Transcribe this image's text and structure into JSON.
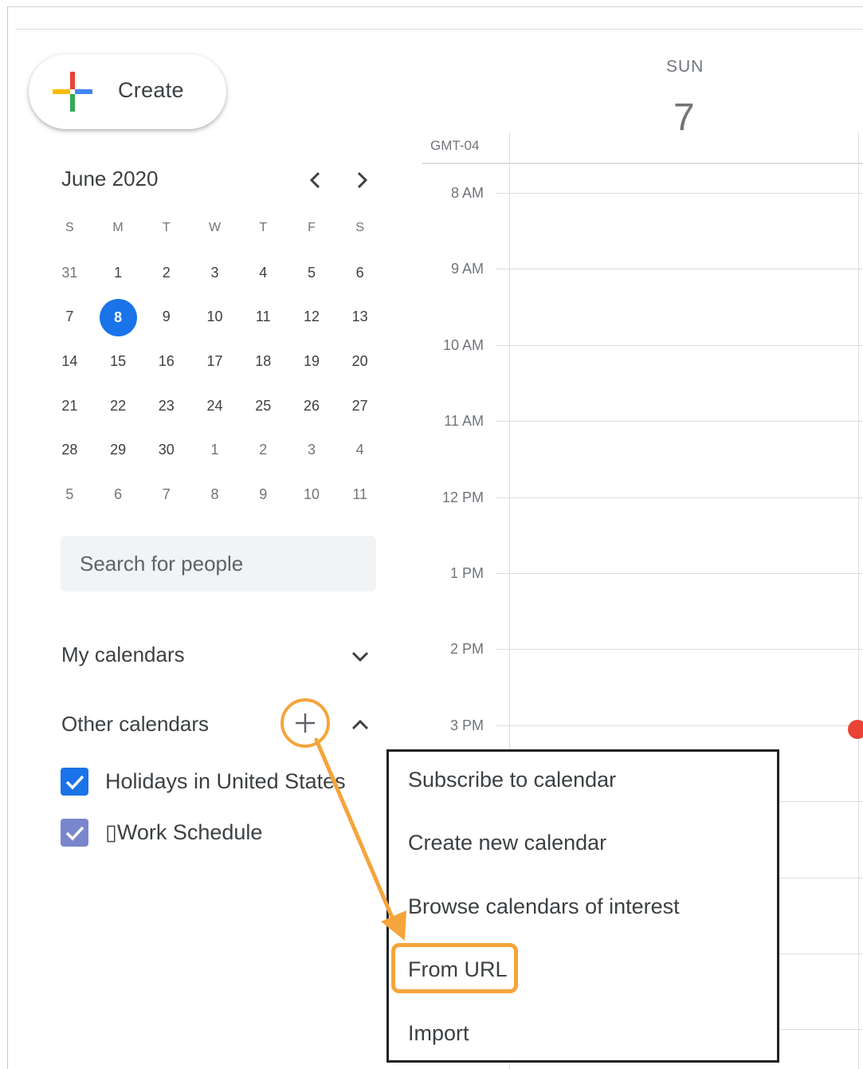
{
  "create_button": {
    "label": "Create"
  },
  "mini_calendar": {
    "month_title": "June 2020",
    "weekday_headers": [
      "S",
      "M",
      "T",
      "W",
      "T",
      "F",
      "S"
    ],
    "weeks": [
      [
        "31",
        "1",
        "2",
        "3",
        "4",
        "5",
        "6"
      ],
      [
        "7",
        "8",
        "9",
        "10",
        "11",
        "12",
        "13"
      ],
      [
        "14",
        "15",
        "16",
        "17",
        "18",
        "19",
        "20"
      ],
      [
        "21",
        "22",
        "23",
        "24",
        "25",
        "26",
        "27"
      ],
      [
        "28",
        "29",
        "30",
        "1",
        "2",
        "3",
        "4"
      ],
      [
        "5",
        "6",
        "7",
        "8",
        "9",
        "10",
        "11"
      ]
    ],
    "today": "8",
    "accent_color": "#1a73e8"
  },
  "search_people": {
    "placeholder": "Search for people"
  },
  "my_calendars": {
    "title": "My calendars"
  },
  "other_calendars": {
    "title": "Other calendars",
    "items": [
      {
        "label": "Holidays in United States",
        "color": "#1a73e8",
        "checked": true
      },
      {
        "label": "▯Work Schedule",
        "color": "#7986cb",
        "checked": true
      }
    ]
  },
  "day_view": {
    "day_name": "SUN",
    "day_number": "7",
    "timezone": "GMT-04",
    "hours": [
      "8 AM",
      "9 AM",
      "10 AM",
      "11 AM",
      "12 PM",
      "1 PM",
      "2 PM",
      "3 PM"
    ]
  },
  "add_menu": {
    "items": [
      "Subscribe to calendar",
      "Create new calendar",
      "Browse calendars of interest",
      "From URL",
      "Import"
    ],
    "highlighted": "From URL",
    "highlight_color": "#f4a53b"
  }
}
